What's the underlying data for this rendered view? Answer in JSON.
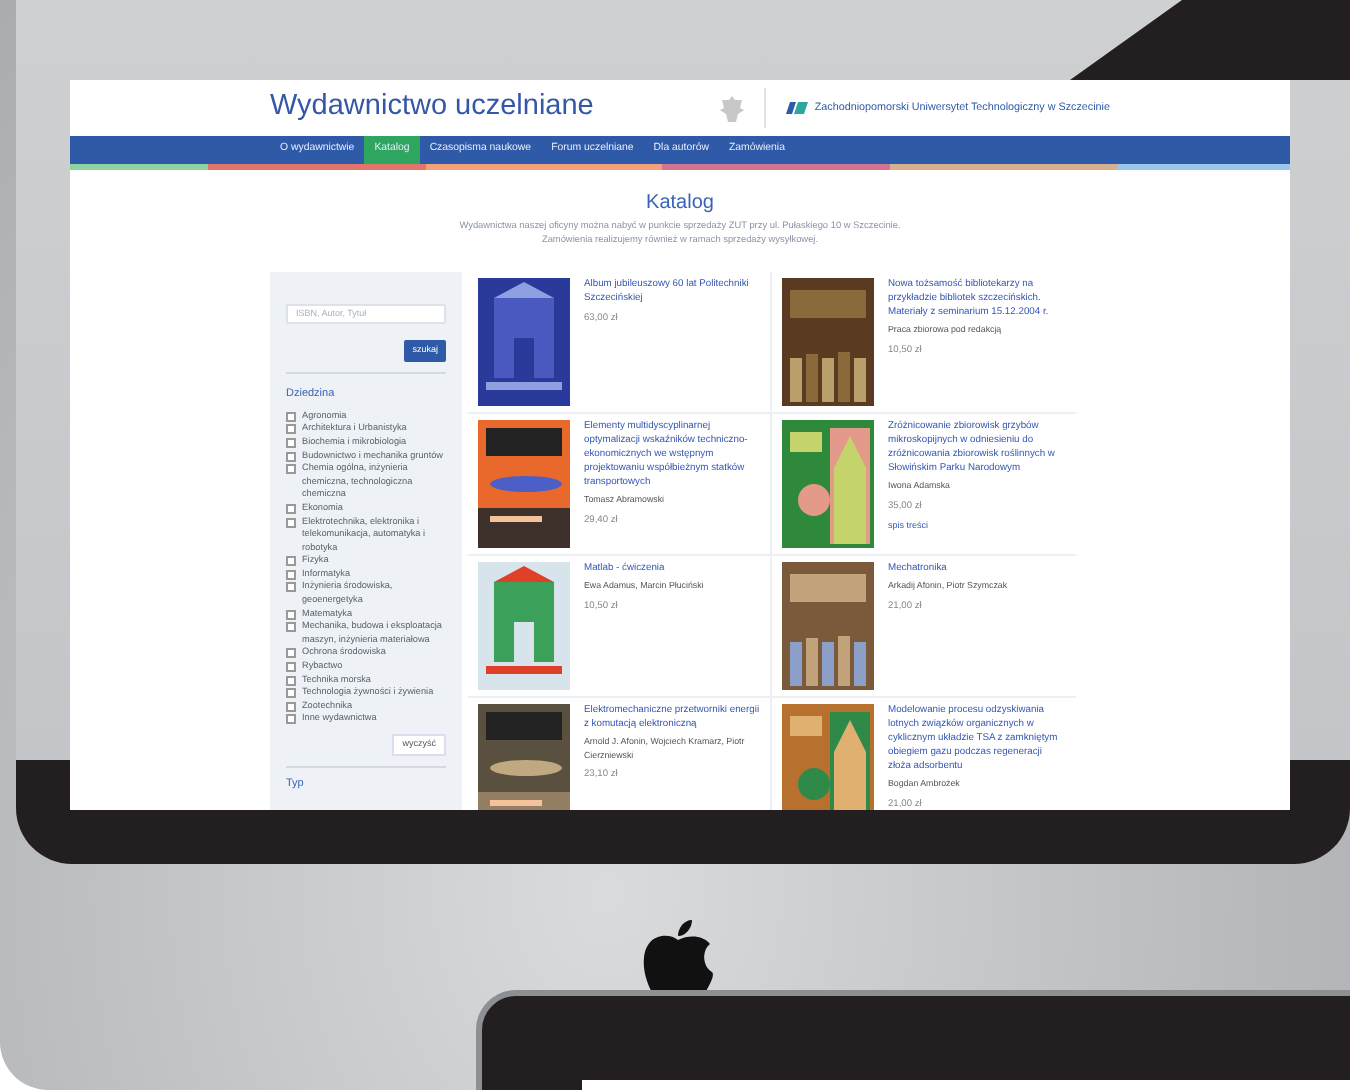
{
  "site": {
    "title": "Wydawnictwo uczelniane",
    "university": "Zachodniopomorski Uniwersytet Technologiczny w Szczecinie"
  },
  "nav": [
    {
      "label": "O wydawnictwie",
      "selected": false
    },
    {
      "label": "Katalog",
      "selected": true
    },
    {
      "label": "Czasopisma naukowe",
      "selected": false
    },
    {
      "label": "Forum uczelniane",
      "selected": false
    },
    {
      "label": "Dla autorów",
      "selected": false
    },
    {
      "label": "Zamówienia",
      "selected": false
    }
  ],
  "page": {
    "heading": "Katalog",
    "intro": [
      "Wydawnictwa naszej oficyny można nabyć w punkcie sprzedaży ZUT przy ul. Pułaskiego 10 w Szczecinie.",
      "Zamówienia realizujemy również w ramach sprzedaży wysyłkowej."
    ]
  },
  "sidebar": {
    "search_placeholder": "ISBN, Autor, Tytuł",
    "search_button": "szukaj",
    "section": "Dziedzina",
    "categories": [
      {
        "label": "Agronomia",
        "checked": false
      },
      {
        "label": "Architektura i Urbanistyka",
        "checked": false
      },
      {
        "label": "Biochemia i mikrobiologia",
        "checked": false
      },
      {
        "label": "Budownictwo i mechanika gruntów",
        "checked": false
      },
      {
        "label": "Chemia ogólna, inżynieria chemiczna, technologiczna chemiczna",
        "checked": false
      },
      {
        "label": "Ekonomia",
        "checked": false
      },
      {
        "label": "Elektrotechnika, elektronika i telekomunikacja, automatyka i robotyka",
        "checked": false
      },
      {
        "label": "Fizyka",
        "checked": false
      },
      {
        "label": "Informatyka",
        "checked": false
      },
      {
        "label": "Inżynieria środowiska, geoenergetyka",
        "checked": false
      },
      {
        "label": "Matematyka",
        "checked": false
      },
      {
        "label": "Mechanika, budowa i eksploatacja maszyn, inżynieria materiałowa",
        "checked": false
      },
      {
        "label": "Ochrona środowiska",
        "checked": false
      },
      {
        "label": "Rybactwo",
        "checked": false
      },
      {
        "label": "Technika morska",
        "checked": false
      },
      {
        "label": "Technologia żywności i żywienia",
        "checked": false
      },
      {
        "label": "Zootechnika",
        "checked": false
      },
      {
        "label": "Inne wydawnictwa",
        "checked": false
      }
    ],
    "clear_button": "wyczyść",
    "next_section": "Typ"
  },
  "products": [
    {
      "title": "Album jubileuszowy 60 lat Politechniki Szczecińskiej",
      "price": "63,00 zł"
    },
    {
      "title": "Nowa tożsamość bibliotekarzy na przykładzie bibliotek szczecińskich. Materiały z seminarium 15.12.2004 r.",
      "author": "Praca zbiorowa pod redakcją",
      "price": "10,50 zł"
    },
    {
      "title": "Elementy multidyscyplinarnej optymalizacji wskaźników techniczno-ekonomicznych we wstępnym projektowaniu współbieżnym statków transportowych",
      "author": "Tomasz Abramowski",
      "price": "29,40 zł"
    },
    {
      "title": "Zróżnicowanie zbiorowisk grzybów mikroskopijnych w odniesieniu do zróżnicowania zbiorowisk roślinnych w Słowińskim Parku Narodowym",
      "author": "Iwona Adamska",
      "price": "35,00 zł",
      "link": "spis treści"
    },
    {
      "title": "Matlab - ćwiczenia",
      "author": "Ewa Adamus, Marcin Płuciński",
      "price": "10,50 zł"
    },
    {
      "title": "Mechatronika",
      "author": "Arkadij Afonin, Piotr Szymczak",
      "price": "21,00 zł"
    },
    {
      "title": "Elektromechaniczne przetworniki energii z komutacją elektroniczną",
      "author": "Arnold J. Afonin, Wojciech Kramarz, Piotr Cierzniewski",
      "price": "23,10 zł"
    },
    {
      "title": "Modelowanie procesu odzyskiwania lotnych związków organicznych w cyklicznym układzie TSA z zamkniętym obiegiem gazu podczas regeneracji złoża adsorbentu",
      "author": "Bogdan Ambrożek",
      "price": "21,00 zł"
    }
  ]
}
